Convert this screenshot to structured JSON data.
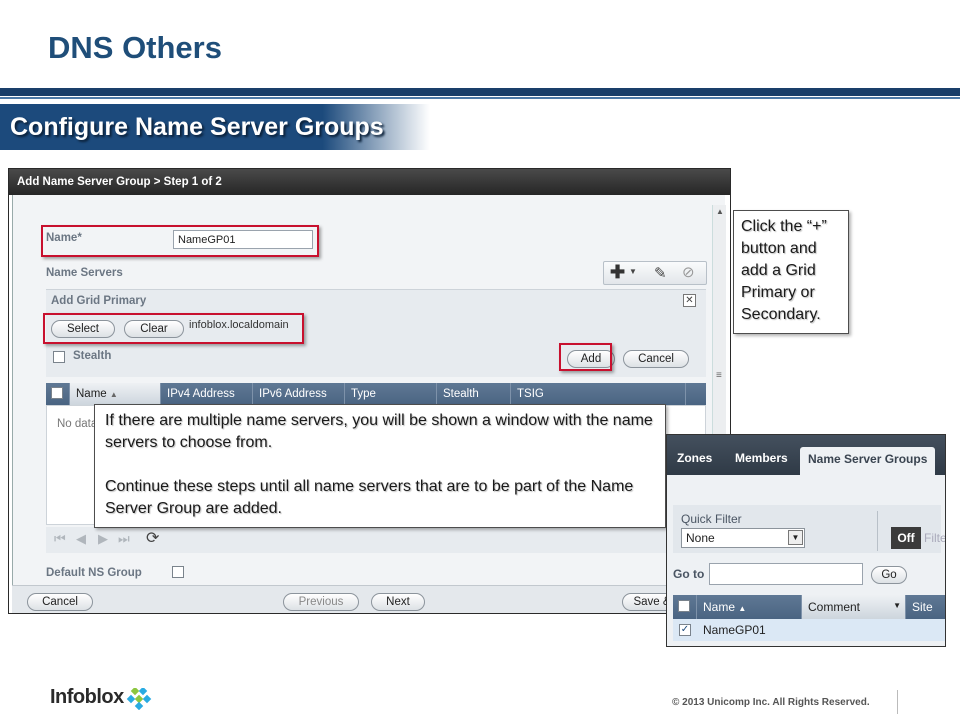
{
  "slide": {
    "title": "DNS Others",
    "section": "Configure Name Server Groups",
    "copyright": "© 2013 Unicomp Inc. All Rights Reserved.",
    "logo_text": "Infoblox"
  },
  "dialog": {
    "title": "Add Name Server Group > Step 1 of 2",
    "name_label": "Name*",
    "name_value": "NameGP01",
    "name_servers_label": "Name Servers",
    "grid_primary_title": "Add Grid Primary",
    "select_label": "Select",
    "clear_label": "Clear",
    "selected_member": "infoblox.localdomain",
    "stealth_label": "Stealth",
    "add_label": "Add",
    "cancel_label": "Cancel",
    "columns": [
      "Name",
      "IPv4 Address",
      "IPv6 Address",
      "Type",
      "Stealth",
      "TSIG"
    ],
    "no_data": "No data",
    "default_ns_group_label": "Default NS Group",
    "footer": {
      "cancel": "Cancel",
      "previous": "Previous",
      "next": "Next",
      "save": "Save &"
    }
  },
  "callouts": {
    "plus_hint": "Click the “+” button and add a Grid Primary or Secondary.",
    "multi_1": "If there are multiple name servers, you will be shown a window with the name servers to choose from.",
    "multi_2": "Continue these steps until all name servers that are to be part of the Name Server Group are added."
  },
  "inset": {
    "tabs": [
      "Zones",
      "Members",
      "Name Server Groups"
    ],
    "active_tab": "Name Server Groups",
    "quick_filter_label": "Quick Filter",
    "quick_filter_value": "None",
    "off_label": "Off",
    "filter_label_partial": "Filte",
    "goto_label": "Go to",
    "go_button": "Go",
    "columns": [
      "Name",
      "Comment",
      "Site"
    ],
    "rows": [
      {
        "name": "NameGP01",
        "checked": true
      }
    ]
  },
  "colors": {
    "title_blue": "#1f4e79",
    "banner_blue": "#1c4a7c",
    "highlight_red": "#c8102e",
    "grid_header": "#4a6482"
  }
}
